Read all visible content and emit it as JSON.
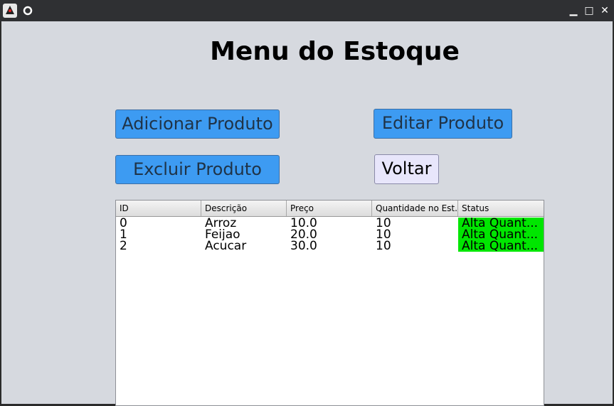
{
  "titlebar": {
    "app_icon": "java-duke-icon",
    "secondary_icon": "circle-icon",
    "minimize_glyph": "▁",
    "maximize_glyph": "□",
    "close_glyph": "✕"
  },
  "main": {
    "title": "Menu do Estoque",
    "buttons": {
      "add": "Adicionar Produto",
      "edit": "Editar Produto",
      "delete": "Excluir Produto",
      "back": "Voltar"
    }
  },
  "table": {
    "columns": [
      "ID",
      "Descrição",
      "Preço",
      "Quantidade no Est...",
      "Status"
    ],
    "rows": [
      [
        "0",
        "Arroz",
        "10.0",
        "10",
        "Alta Quant..."
      ],
      [
        "1",
        "Feijao",
        "20.0",
        "10",
        "Alta Quant..."
      ],
      [
        "2",
        "Acucar",
        "30.0",
        "10",
        "Alta Quant..."
      ]
    ],
    "status_color": "#00e600"
  }
}
